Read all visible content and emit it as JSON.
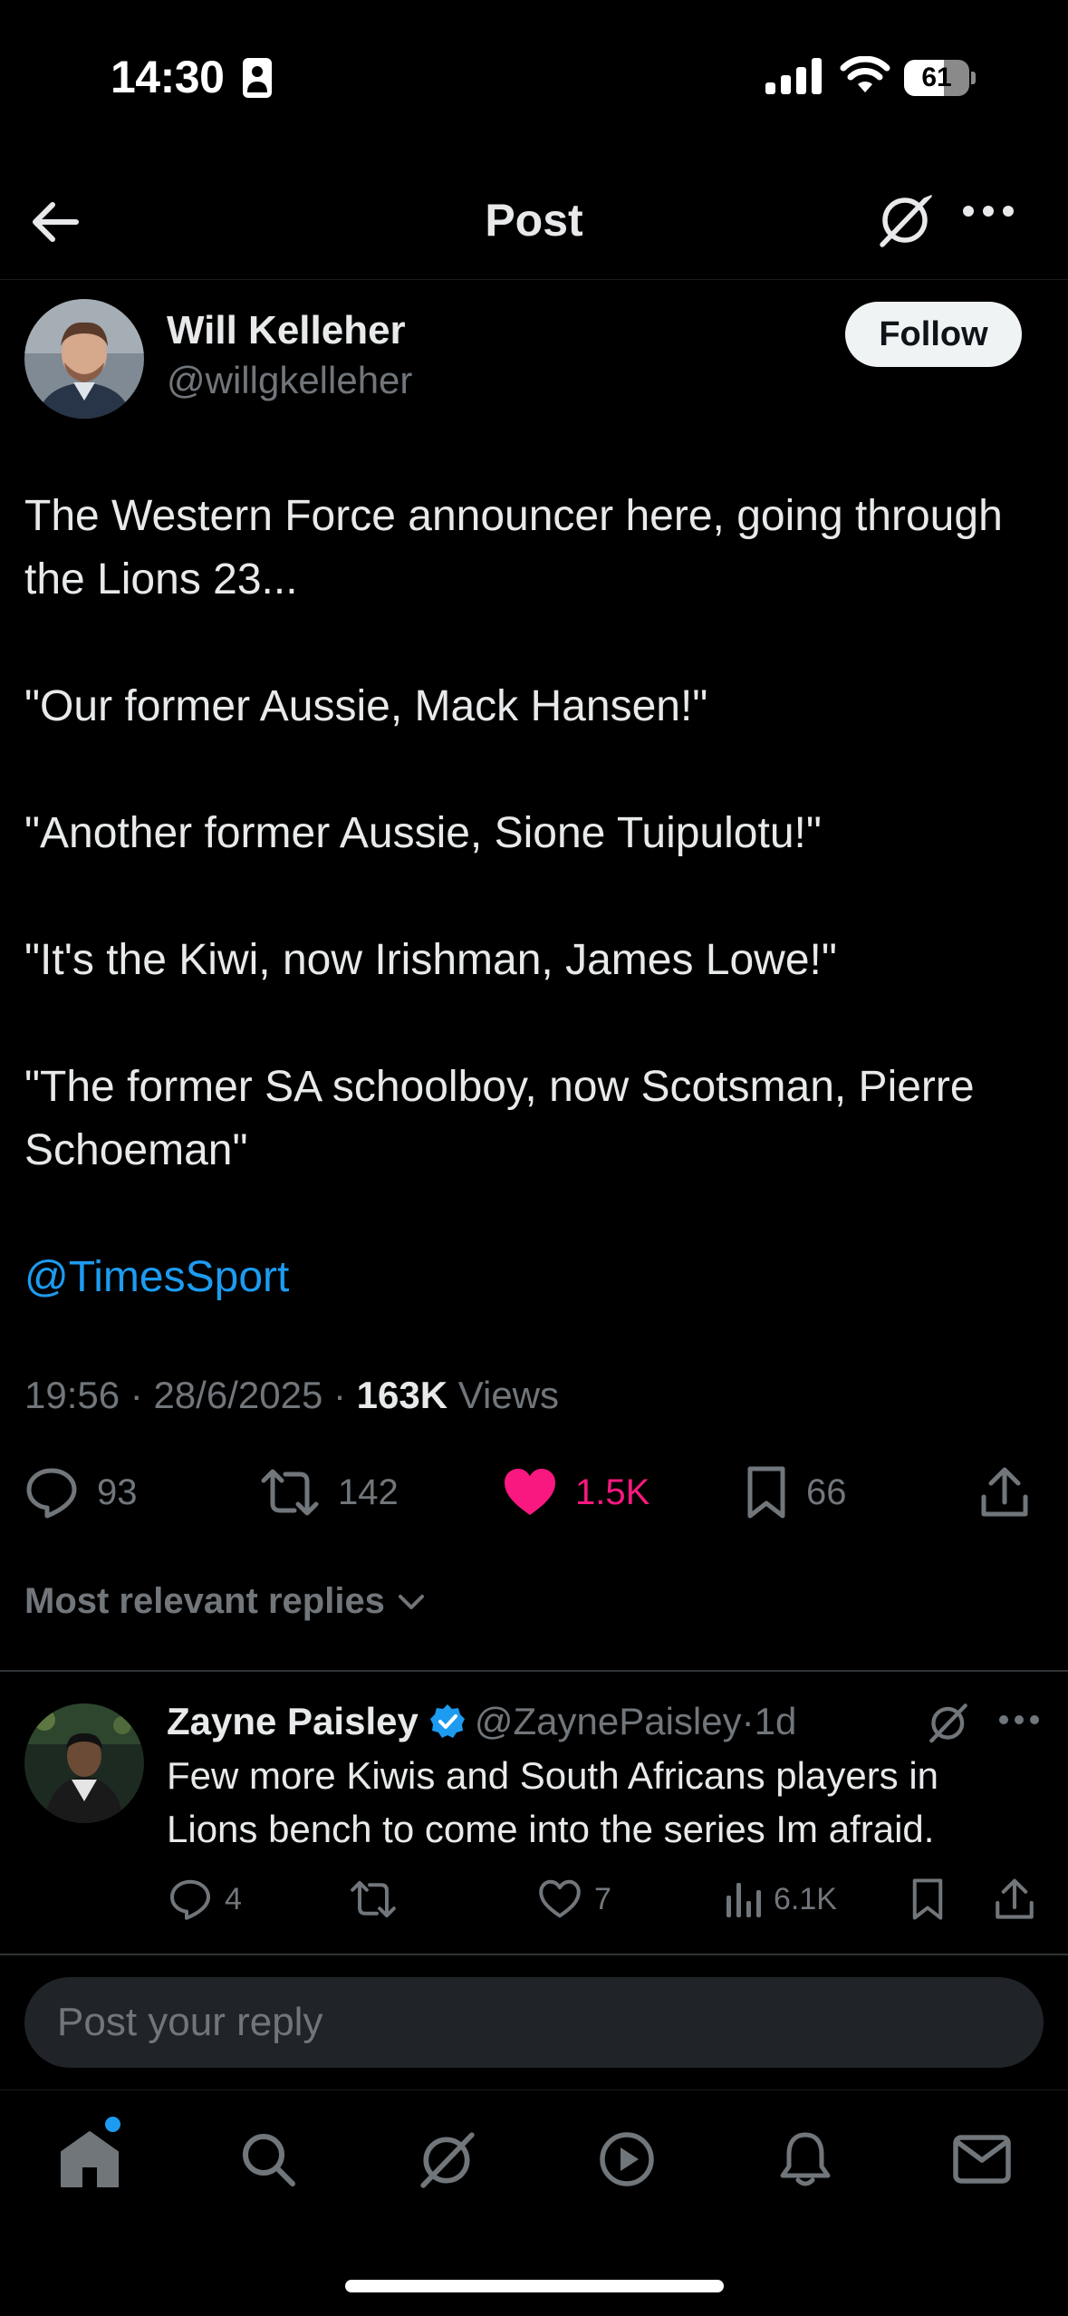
{
  "status_bar": {
    "time": "14:30",
    "battery": "61",
    "battery_level": 0.61,
    "icons": [
      "lock-screen-icon",
      "cellular-signal-icon",
      "wifi-icon",
      "battery-icon"
    ]
  },
  "header": {
    "title": "Post",
    "icons": [
      "back-arrow-icon",
      "grok-icon",
      "more-options-icon"
    ]
  },
  "post": {
    "author_name": "Will Kelleher",
    "author_handle": "@willgkelleher",
    "follow_label": "Follow",
    "body": [
      "The Western Force announcer here, going through the Lions 23...",
      "\"Our former Aussie, Mack Hansen!\"",
      "\"Another former Aussie, Sione Tuipulotu!\"",
      "\"It's the Kiwi, now Irishman, James Lowe!\"",
      "\"The former SA schoolboy, now Scotsman, Pierre Schoeman\""
    ],
    "mention": "@TimesSport",
    "time": "19:56",
    "date": "28/6/2025",
    "views_count": "163K",
    "views_label": "Views",
    "separator": "·",
    "stats": {
      "replies": "93",
      "reposts": "142",
      "likes": "1.5K",
      "bookmarks": "66"
    },
    "liked": true
  },
  "replies_filter": {
    "label": "Most relevant replies"
  },
  "reply": {
    "name": "Zayne Paisley",
    "verified": true,
    "handle": "@ZaynePaisley",
    "separator": "·",
    "time": "1d",
    "text": "Few more Kiwis and South Africans players in Lions bench to come into the series Im afraid.",
    "stats": {
      "replies": "4",
      "likes": "7",
      "views": "6.1K"
    }
  },
  "composer": {
    "placeholder": "Post your reply"
  },
  "tab_bar": {
    "tabs": [
      "home-icon",
      "search-icon",
      "grok-icon",
      "video-icon",
      "notifications-icon",
      "messages-icon"
    ],
    "active": "home",
    "home_has_new": true
  },
  "colors": {
    "background": "#000000",
    "text_primary": "#e7e9ea",
    "text_secondary": "#71767b",
    "link": "#1d9bf0",
    "like": "#f91880",
    "follow_button": "#eff3f4",
    "composer": "#202327"
  }
}
